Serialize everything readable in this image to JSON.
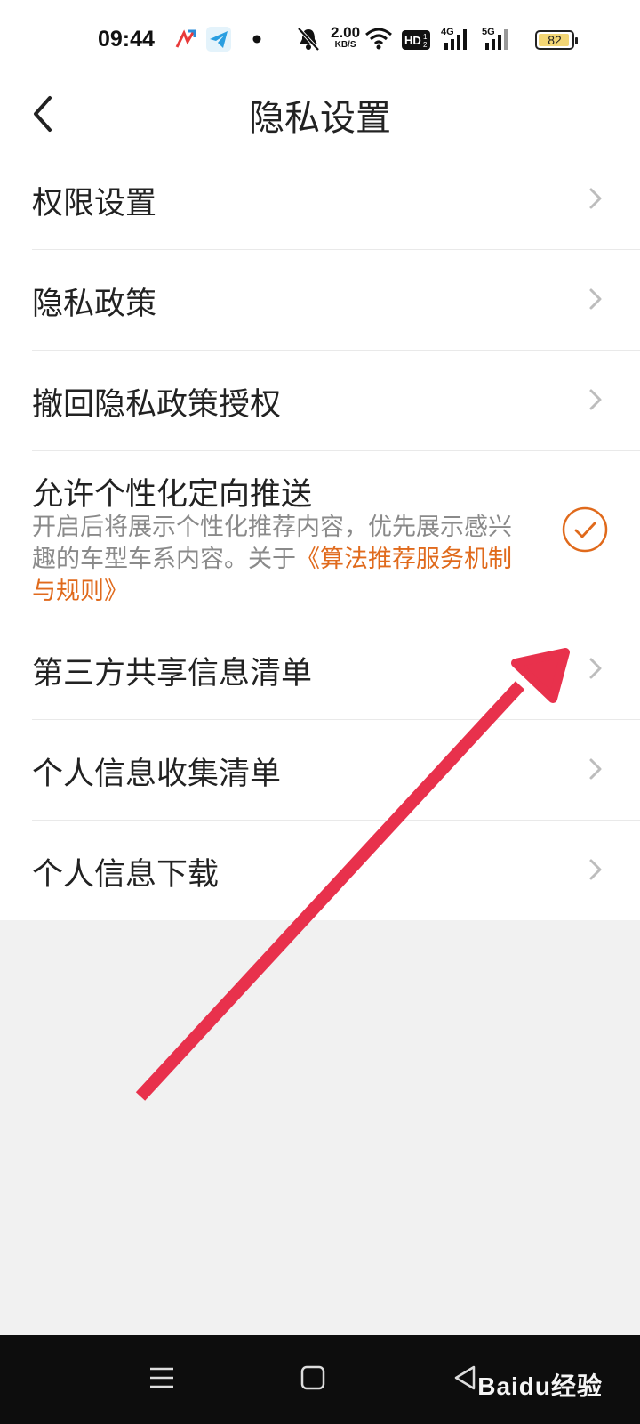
{
  "status_bar": {
    "time": "09:44",
    "net_speed": "2.00",
    "net_unit": "KB/S",
    "battery": "82",
    "icons": [
      "notification-app-icon",
      "telegram-icon",
      "dot-icon",
      "mute-bell-icon",
      "wifi-icon",
      "hd-icon",
      "signal-4g-icon",
      "signal-5g-icon",
      "battery-icon"
    ]
  },
  "header": {
    "title": "隐私设置",
    "back_icon": "chevron-left-icon"
  },
  "menu": {
    "permissions": "权限设置",
    "privacy_policy": "隐私政策",
    "revoke_authorization": "撤回隐私政策授权",
    "personalization": {
      "label": "允许个性化定向推送",
      "desc": "开启后将展示个性化推荐内容，优先展示感兴趣的车型车系内容。关于",
      "link": "《算法推荐服务机制与规则》",
      "enabled": true
    },
    "third_party_list": "第三方共享信息清单",
    "collection_list": "个人信息收集清单",
    "download": "个人信息下载"
  },
  "watermark": "Baidu经验",
  "colors": {
    "accent": "#e06a1c",
    "arrow": "#e8314c"
  }
}
